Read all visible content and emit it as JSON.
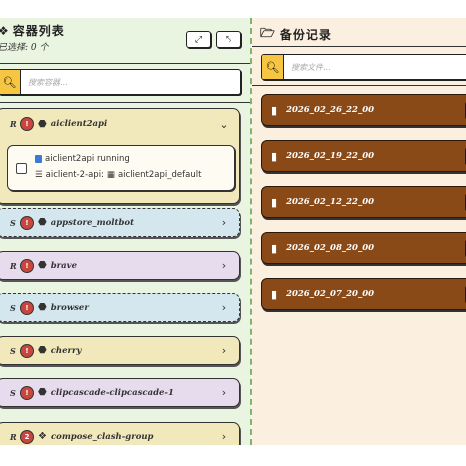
{
  "left": {
    "title": "容器列表",
    "selected_text": "已选择: 0 个",
    "search_placeholder": "搜索容器...",
    "containers": [
      {
        "status": "R",
        "badge": "!",
        "name": "aiclient2api",
        "icon": "cube-icon",
        "expanded": true,
        "color": "yellow"
      },
      {
        "status": "S",
        "badge": "!",
        "name": "appstore_moltbot",
        "icon": "cube-icon",
        "expanded": false,
        "color": "blue"
      },
      {
        "status": "R",
        "badge": "!",
        "name": "brave",
        "icon": "cube-icon",
        "expanded": false,
        "color": "purple"
      },
      {
        "status": "S",
        "badge": "!",
        "name": "browser",
        "icon": "cube-icon",
        "expanded": false,
        "color": "blue"
      },
      {
        "status": "S",
        "badge": "!",
        "name": "cherry",
        "icon": "cube-icon",
        "expanded": false,
        "color": "yellow"
      },
      {
        "status": "S",
        "badge": "!",
        "name": "clipcascade-clipcascade-1",
        "icon": "cube-icon",
        "expanded": false,
        "color": "purple"
      },
      {
        "status": "R",
        "badge": "2",
        "name": "compose_clash-group",
        "icon": "cubes-icon",
        "expanded": false,
        "color": "yellow"
      }
    ],
    "detail": {
      "service_line": "aiclient2api running",
      "network_prefix": "aiclient-2-api:",
      "network_name": "aiclient2api_default"
    }
  },
  "right": {
    "title": "备份记录",
    "search_placeholder": "搜索文件...",
    "folders": [
      "2026_02_26_22_00",
      "2026_02_19_22_00",
      "2026_02_12_22_00",
      "2026_02_08_20_00",
      "2026_02_07_20_00"
    ]
  },
  "colors": {
    "left_bg": "#eaf5e1",
    "right_bg": "#fbf0df",
    "folder": "#8a4a18",
    "badge": "#c8463d",
    "search_button": "#f6c542"
  }
}
